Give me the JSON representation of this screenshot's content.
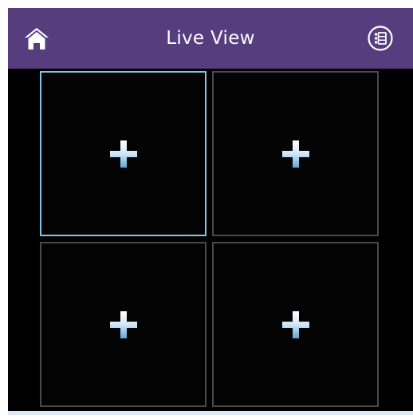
{
  "header": {
    "title": "Live View",
    "home_icon": "home-icon",
    "list_icon": "camera-list-icon",
    "background_color": "#553d7e"
  },
  "grid": {
    "layout": "2x2",
    "selected_index": 0,
    "selected_border_color": "#84c4ea",
    "cells": [
      {
        "icon": "add-camera-plus-icon"
      },
      {
        "icon": "add-camera-plus-icon"
      },
      {
        "icon": "add-camera-plus-icon"
      },
      {
        "icon": "add-camera-plus-icon"
      }
    ]
  }
}
